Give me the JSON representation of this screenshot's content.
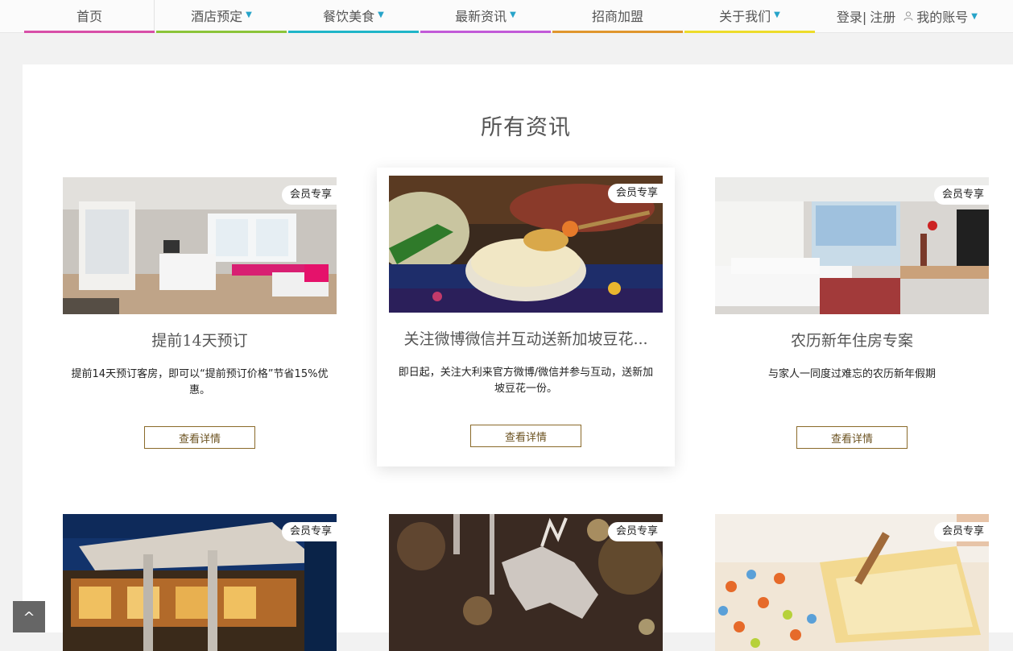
{
  "nav": {
    "items": [
      {
        "label": "首页",
        "dropdown": false,
        "color": "#d84fa8"
      },
      {
        "label": "酒店预定",
        "dropdown": true,
        "color": "#8cc43a"
      },
      {
        "label": "餐饮美食",
        "dropdown": true,
        "color": "#1fb5c8"
      },
      {
        "label": "最新资讯",
        "dropdown": true,
        "color": "#c15ad8"
      },
      {
        "label": "招商加盟",
        "dropdown": false,
        "color": "#e0962d"
      },
      {
        "label": "关于我们",
        "dropdown": true,
        "color": "#eddc2a"
      }
    ],
    "login": "登录|",
    "register": "注册",
    "account": "我的账号",
    "caret": "▼"
  },
  "section": {
    "title": "所有资讯"
  },
  "cards": [
    {
      "badge": "会员专享",
      "title": "提前14天预订",
      "desc": "提前14天预订客房，即可以“提前预订价格”节省15%优惠。",
      "button": "查看详情"
    },
    {
      "badge": "会员专享",
      "title": "关注微博微信并互动送新加坡豆花...",
      "desc": "即日起，关注大利来官方微博/微信并参与互动，送新加坡豆花一份。",
      "button": "查看详情"
    },
    {
      "badge": "会员专享",
      "title": "农历新年住房专案",
      "desc": "与家人一同度过难忘的农历新年假期",
      "button": "查看详情"
    },
    {
      "badge": "会员专享"
    },
    {
      "badge": "会员专享"
    },
    {
      "badge": "会员专享"
    }
  ],
  "back_to_top": "^"
}
